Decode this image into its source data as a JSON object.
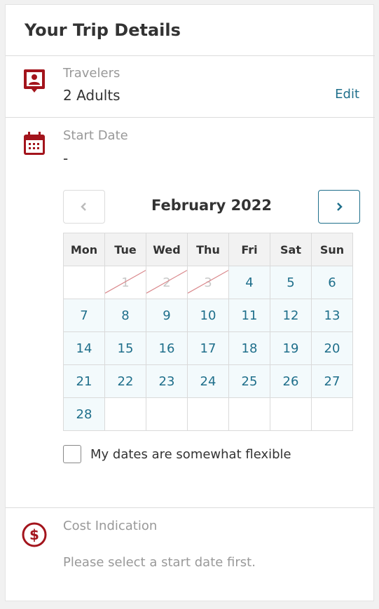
{
  "title": "Your Trip Details",
  "travelers": {
    "label": "Travelers",
    "value": "2 Adults",
    "edit_label": "Edit"
  },
  "start_date": {
    "label": "Start Date",
    "value": "-"
  },
  "calendar": {
    "month_title": "February 2022",
    "weekdays": [
      "Mon",
      "Tue",
      "Wed",
      "Thu",
      "Fri",
      "Sat",
      "Sun"
    ],
    "weeks": [
      [
        {
          "d": ""
        },
        {
          "d": "1",
          "disabled": true
        },
        {
          "d": "2",
          "disabled": true
        },
        {
          "d": "3",
          "disabled": true
        },
        {
          "d": "4"
        },
        {
          "d": "5"
        },
        {
          "d": "6"
        }
      ],
      [
        {
          "d": "7"
        },
        {
          "d": "8"
        },
        {
          "d": "9"
        },
        {
          "d": "10"
        },
        {
          "d": "11"
        },
        {
          "d": "12"
        },
        {
          "d": "13"
        }
      ],
      [
        {
          "d": "14"
        },
        {
          "d": "15"
        },
        {
          "d": "16"
        },
        {
          "d": "17"
        },
        {
          "d": "18"
        },
        {
          "d": "19"
        },
        {
          "d": "20"
        }
      ],
      [
        {
          "d": "21"
        },
        {
          "d": "22"
        },
        {
          "d": "23"
        },
        {
          "d": "24"
        },
        {
          "d": "25"
        },
        {
          "d": "26"
        },
        {
          "d": "27"
        }
      ],
      [
        {
          "d": "28"
        },
        {
          "d": ""
        },
        {
          "d": ""
        },
        {
          "d": ""
        },
        {
          "d": ""
        },
        {
          "d": ""
        },
        {
          "d": ""
        }
      ]
    ],
    "prev_icon": "chevron-left-icon",
    "next_icon": "chevron-right-icon"
  },
  "flexible": {
    "label": "My dates are somewhat flexible",
    "checked": false
  },
  "cost": {
    "label": "Cost Indication",
    "hint": "Please select a start date first."
  },
  "colors": {
    "accent": "#1f6f8b",
    "icon_red": "#a3141c",
    "muted": "#999999"
  }
}
